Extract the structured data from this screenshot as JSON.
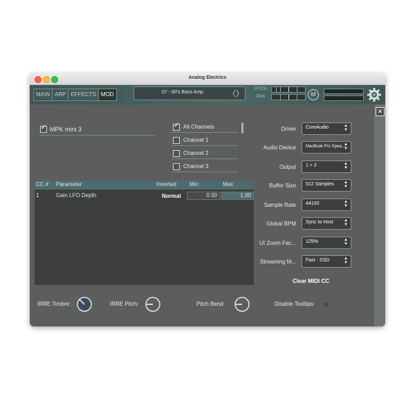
{
  "window": {
    "title": "Analog Electrics"
  },
  "tabs": [
    {
      "label": "MAIN",
      "active": false
    },
    {
      "label": "ARP",
      "active": false
    },
    {
      "label": "EFFECTS",
      "active": false
    },
    {
      "label": "MOD",
      "active": true
    }
  ],
  "preset": {
    "name": "07 - 60's Bass Amp",
    "arrows": "〈〉"
  },
  "top_controls": {
    "pitch_label": "PITCH",
    "pan_label": "PAN",
    "m_label": "M"
  },
  "close_glyph": "✕",
  "device": {
    "name": "MPK mini 3",
    "checked": true
  },
  "channels": [
    {
      "label": "All Channels",
      "checked": true
    },
    {
      "label": "Channel 1",
      "checked": false
    },
    {
      "label": "Channel 2",
      "checked": false
    },
    {
      "label": "Channel 3",
      "checked": false
    }
  ],
  "cc_table": {
    "headers": {
      "cc": "CC #",
      "parameter": "Parameter",
      "inverted": "Inverted",
      "min": "Min",
      "max": "Max"
    },
    "rows": [
      {
        "cc": "1",
        "parameter": "Gain LFO Depth",
        "inverted": "Normal",
        "min": "0.00",
        "max": "1.00"
      }
    ]
  },
  "settings": [
    {
      "label": "Driver",
      "value": "CoreAudio"
    },
    {
      "label": "Audio Device",
      "value": "MacBook Pro Spea..."
    },
    {
      "label": "Output",
      "value": "1 + 2"
    },
    {
      "label": "Buffer Size",
      "value": "512 Samples"
    },
    {
      "label": "Sample Rate",
      "value": "44100"
    },
    {
      "label": "Global BPM",
      "value": "Sync to Host"
    },
    {
      "label": "UI Zoom Fac...",
      "value": "125%"
    },
    {
      "label": "Streaming M...",
      "value": "Fast - SSD"
    }
  ],
  "clear_midi_label": "Clear MIDI CC",
  "bottom": {
    "irre_timbre": "IRRE Timbre:",
    "irre_pitch": "IRRE Pitch:",
    "pitch_bend": "Pitch Bend:",
    "disable_tooltips": "Disable Tooltips:"
  },
  "colors": {
    "accent_blue": "#4e6b70",
    "panel": "#5c5e5e",
    "knob_blue": "#3e4a63"
  }
}
